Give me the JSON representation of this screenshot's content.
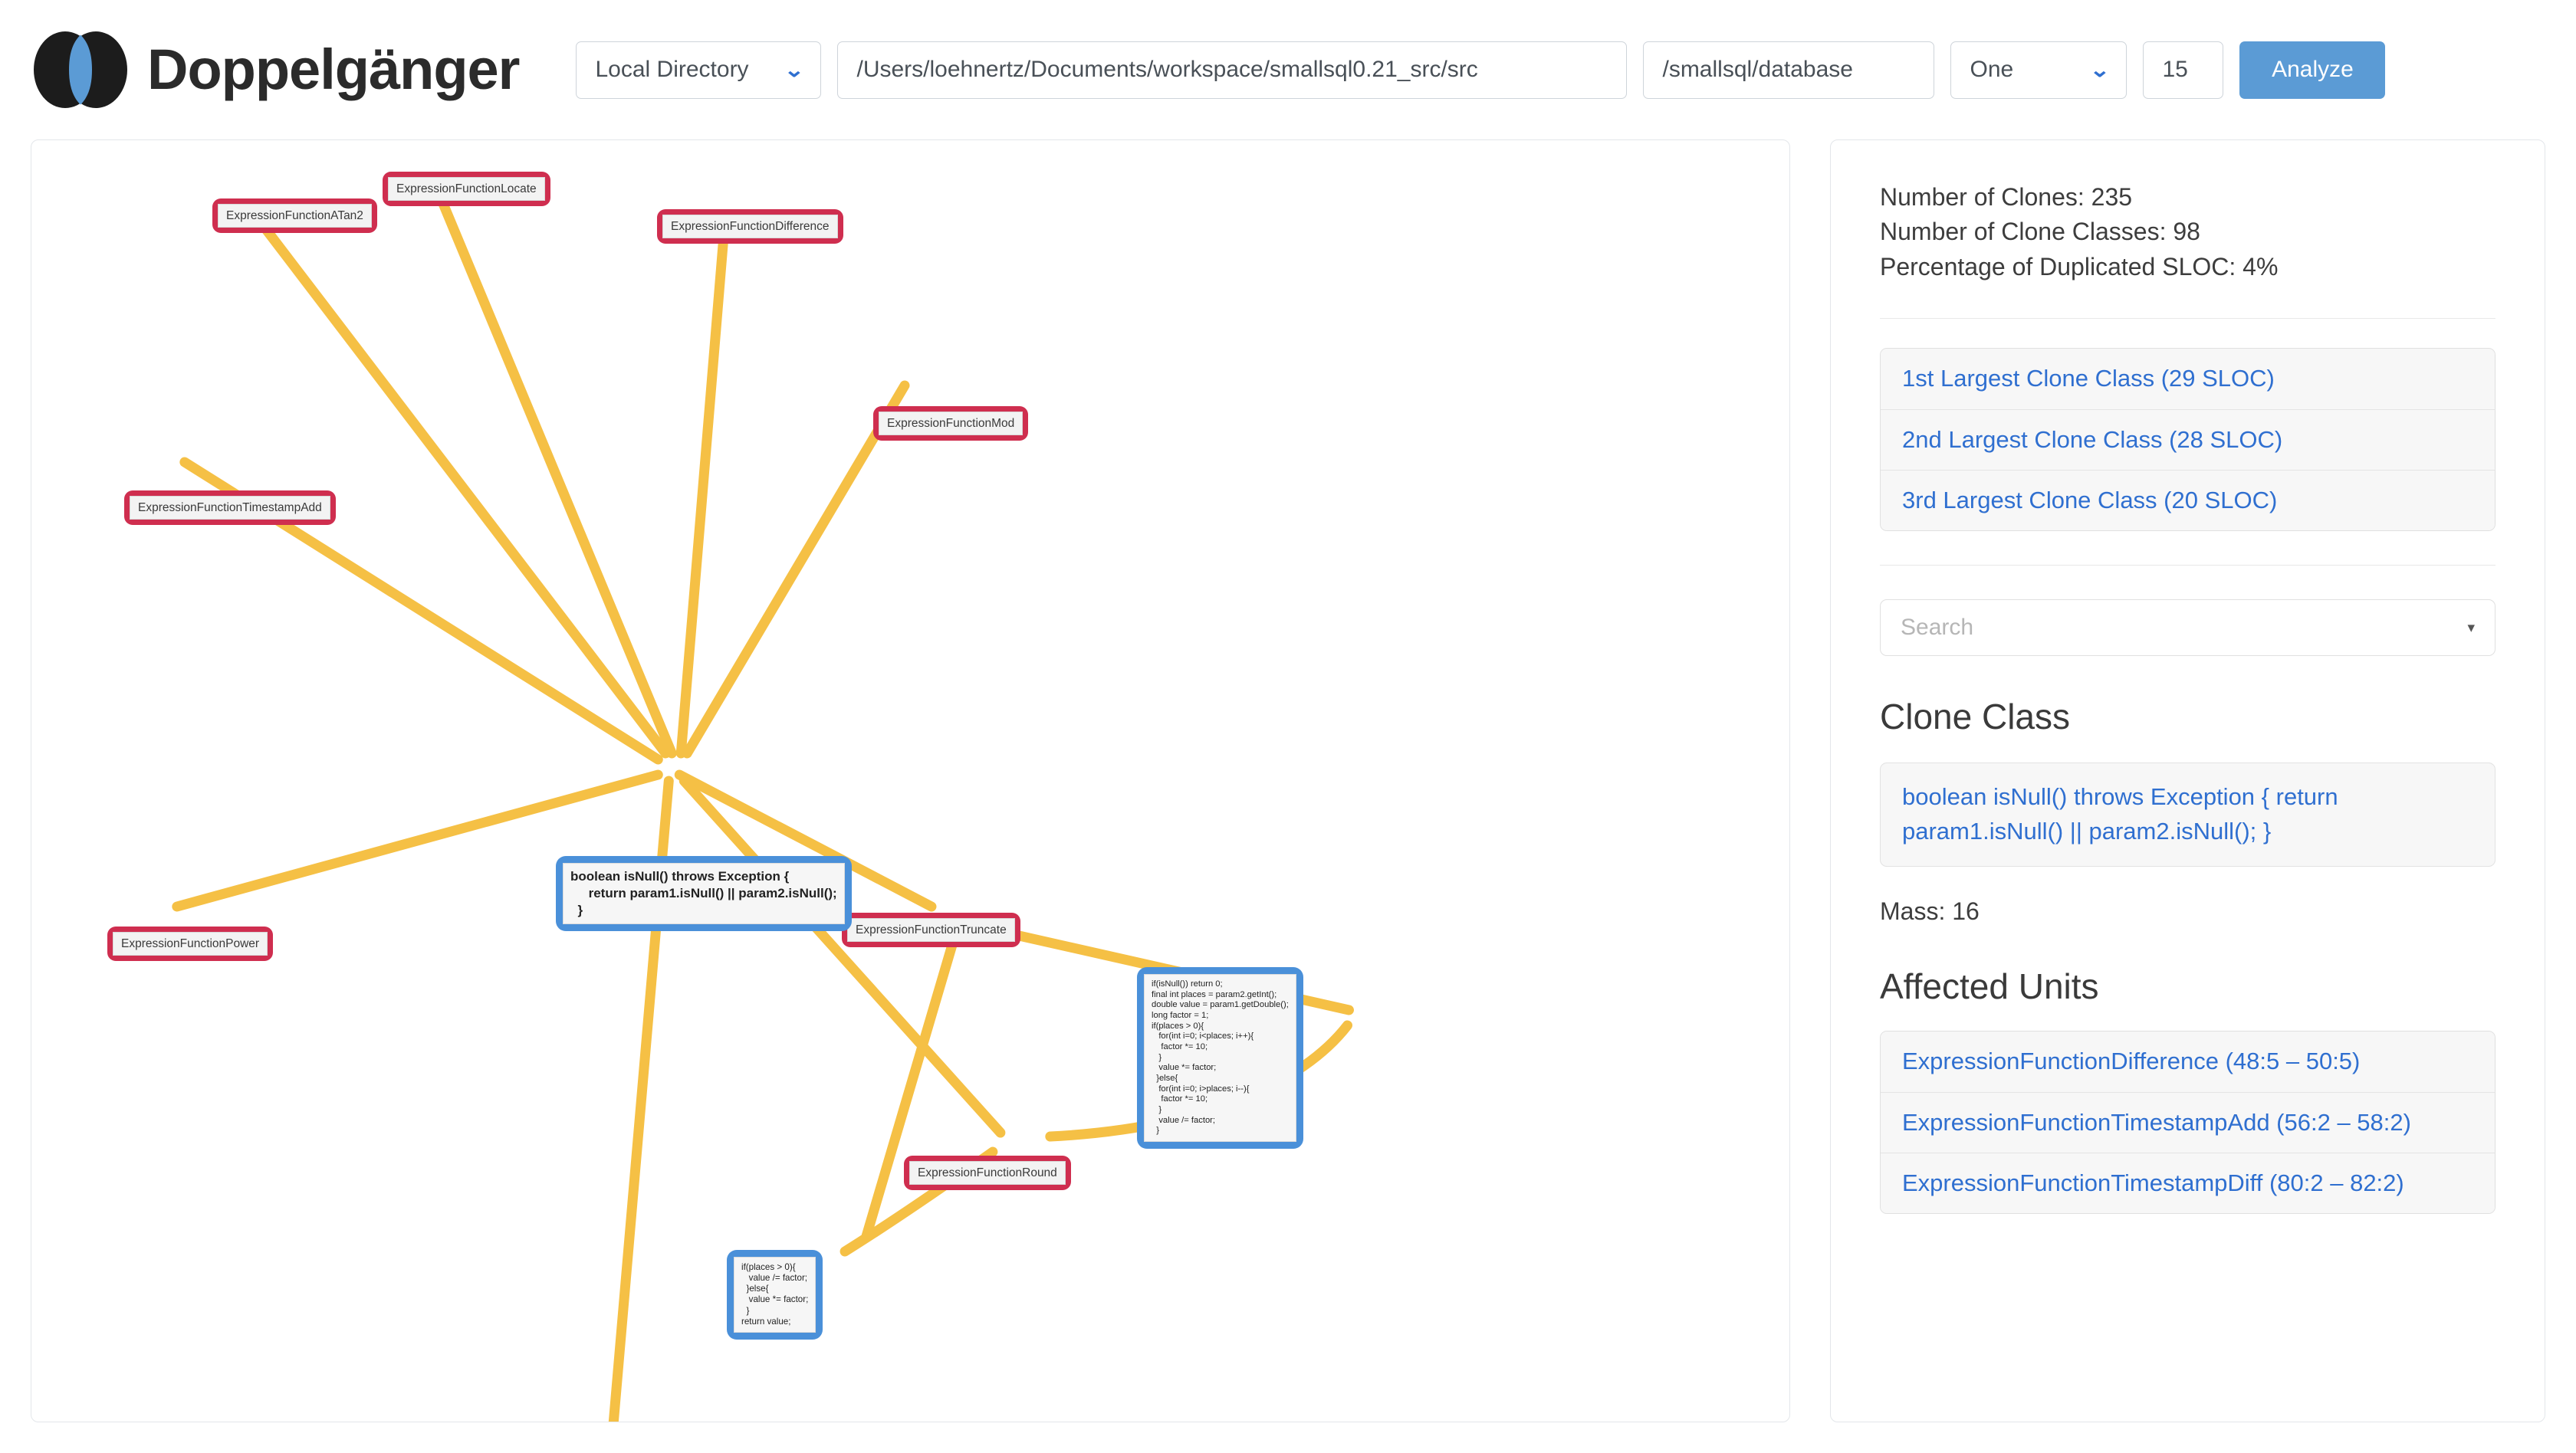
{
  "app": {
    "brand_name": "Doppelgänger",
    "logo_icon": "venn-diagram-logo-icon"
  },
  "toolbar": {
    "source_select": {
      "value": "Local Directory",
      "caret_icon": "chevron-down-icon"
    },
    "path_input": {
      "value": "/Users/loehnertz/Documents/workspace/smallsql0.21_src/src"
    },
    "subpath_input": {
      "value": "/smallsql/database"
    },
    "mode_select": {
      "value": "One",
      "caret_icon": "chevron-down-icon"
    },
    "mass_input": {
      "value": "15"
    },
    "analyze_button": "Analyze"
  },
  "sidebar": {
    "stats": [
      "Number of Clones: 235",
      "Number of Clone Classes: 98",
      "Percentage of Duplicated SLOC: 4%"
    ],
    "largest_clone_classes": [
      "1st Largest Clone Class (29 SLOC)",
      "2nd Largest Clone Class (28 SLOC)",
      "3rd Largest Clone Class (20 SLOC)"
    ],
    "search": {
      "placeholder": "Search",
      "caret_icon": "caret-down-icon"
    },
    "clone_class": {
      "heading": "Clone Class",
      "code": "boolean isNull() throws Exception { return param1.isNull() || param2.isNull(); }",
      "mass": "Mass: 16"
    },
    "affected_units": {
      "heading": "Affected Units",
      "items": [
        "ExpressionFunctionDifference (48:5 – 50:5)",
        "ExpressionFunctionTimestampAdd (56:2 – 58:2)",
        "ExpressionFunctionTimestampDiff (80:2 – 82:2)"
      ]
    }
  },
  "graph": {
    "edge_color": "#f5c045",
    "unit_node_color": "#cf2e4f",
    "clone_node_color": "#4a90d9",
    "nodes": {
      "center": "boolean isNull() throws Exception {\n     return param1.isNull() || param2.isNull();\n  }",
      "atan2": "ExpressionFunctionATan2",
      "locate": "ExpressionFunctionLocate",
      "difference": "ExpressionFunctionDifference",
      "mod": "ExpressionFunctionMod",
      "timestamp_add": "ExpressionFunctionTimestampAdd",
      "power": "ExpressionFunctionPower",
      "truncate": "ExpressionFunctionTruncate",
      "round": "ExpressionFunctionRound",
      "round_code": "if(isNull()) return 0;\nfinal int places = param2.getInt();\ndouble value = param1.getDouble();\nlong factor = 1;\nif(places > 0){\n   for(int i=0; i<places; i++){\n    factor *= 10;\n   }\n   value *= factor;\n  }else{\n   for(int i=0; i>places; i--){\n    factor *= 10;\n   }\n   value /= factor;\n  }",
      "small_code": "if(places > 0){\n   value /= factor;\n  }else{\n   value *= factor;\n  }\nreturn value;"
    }
  }
}
